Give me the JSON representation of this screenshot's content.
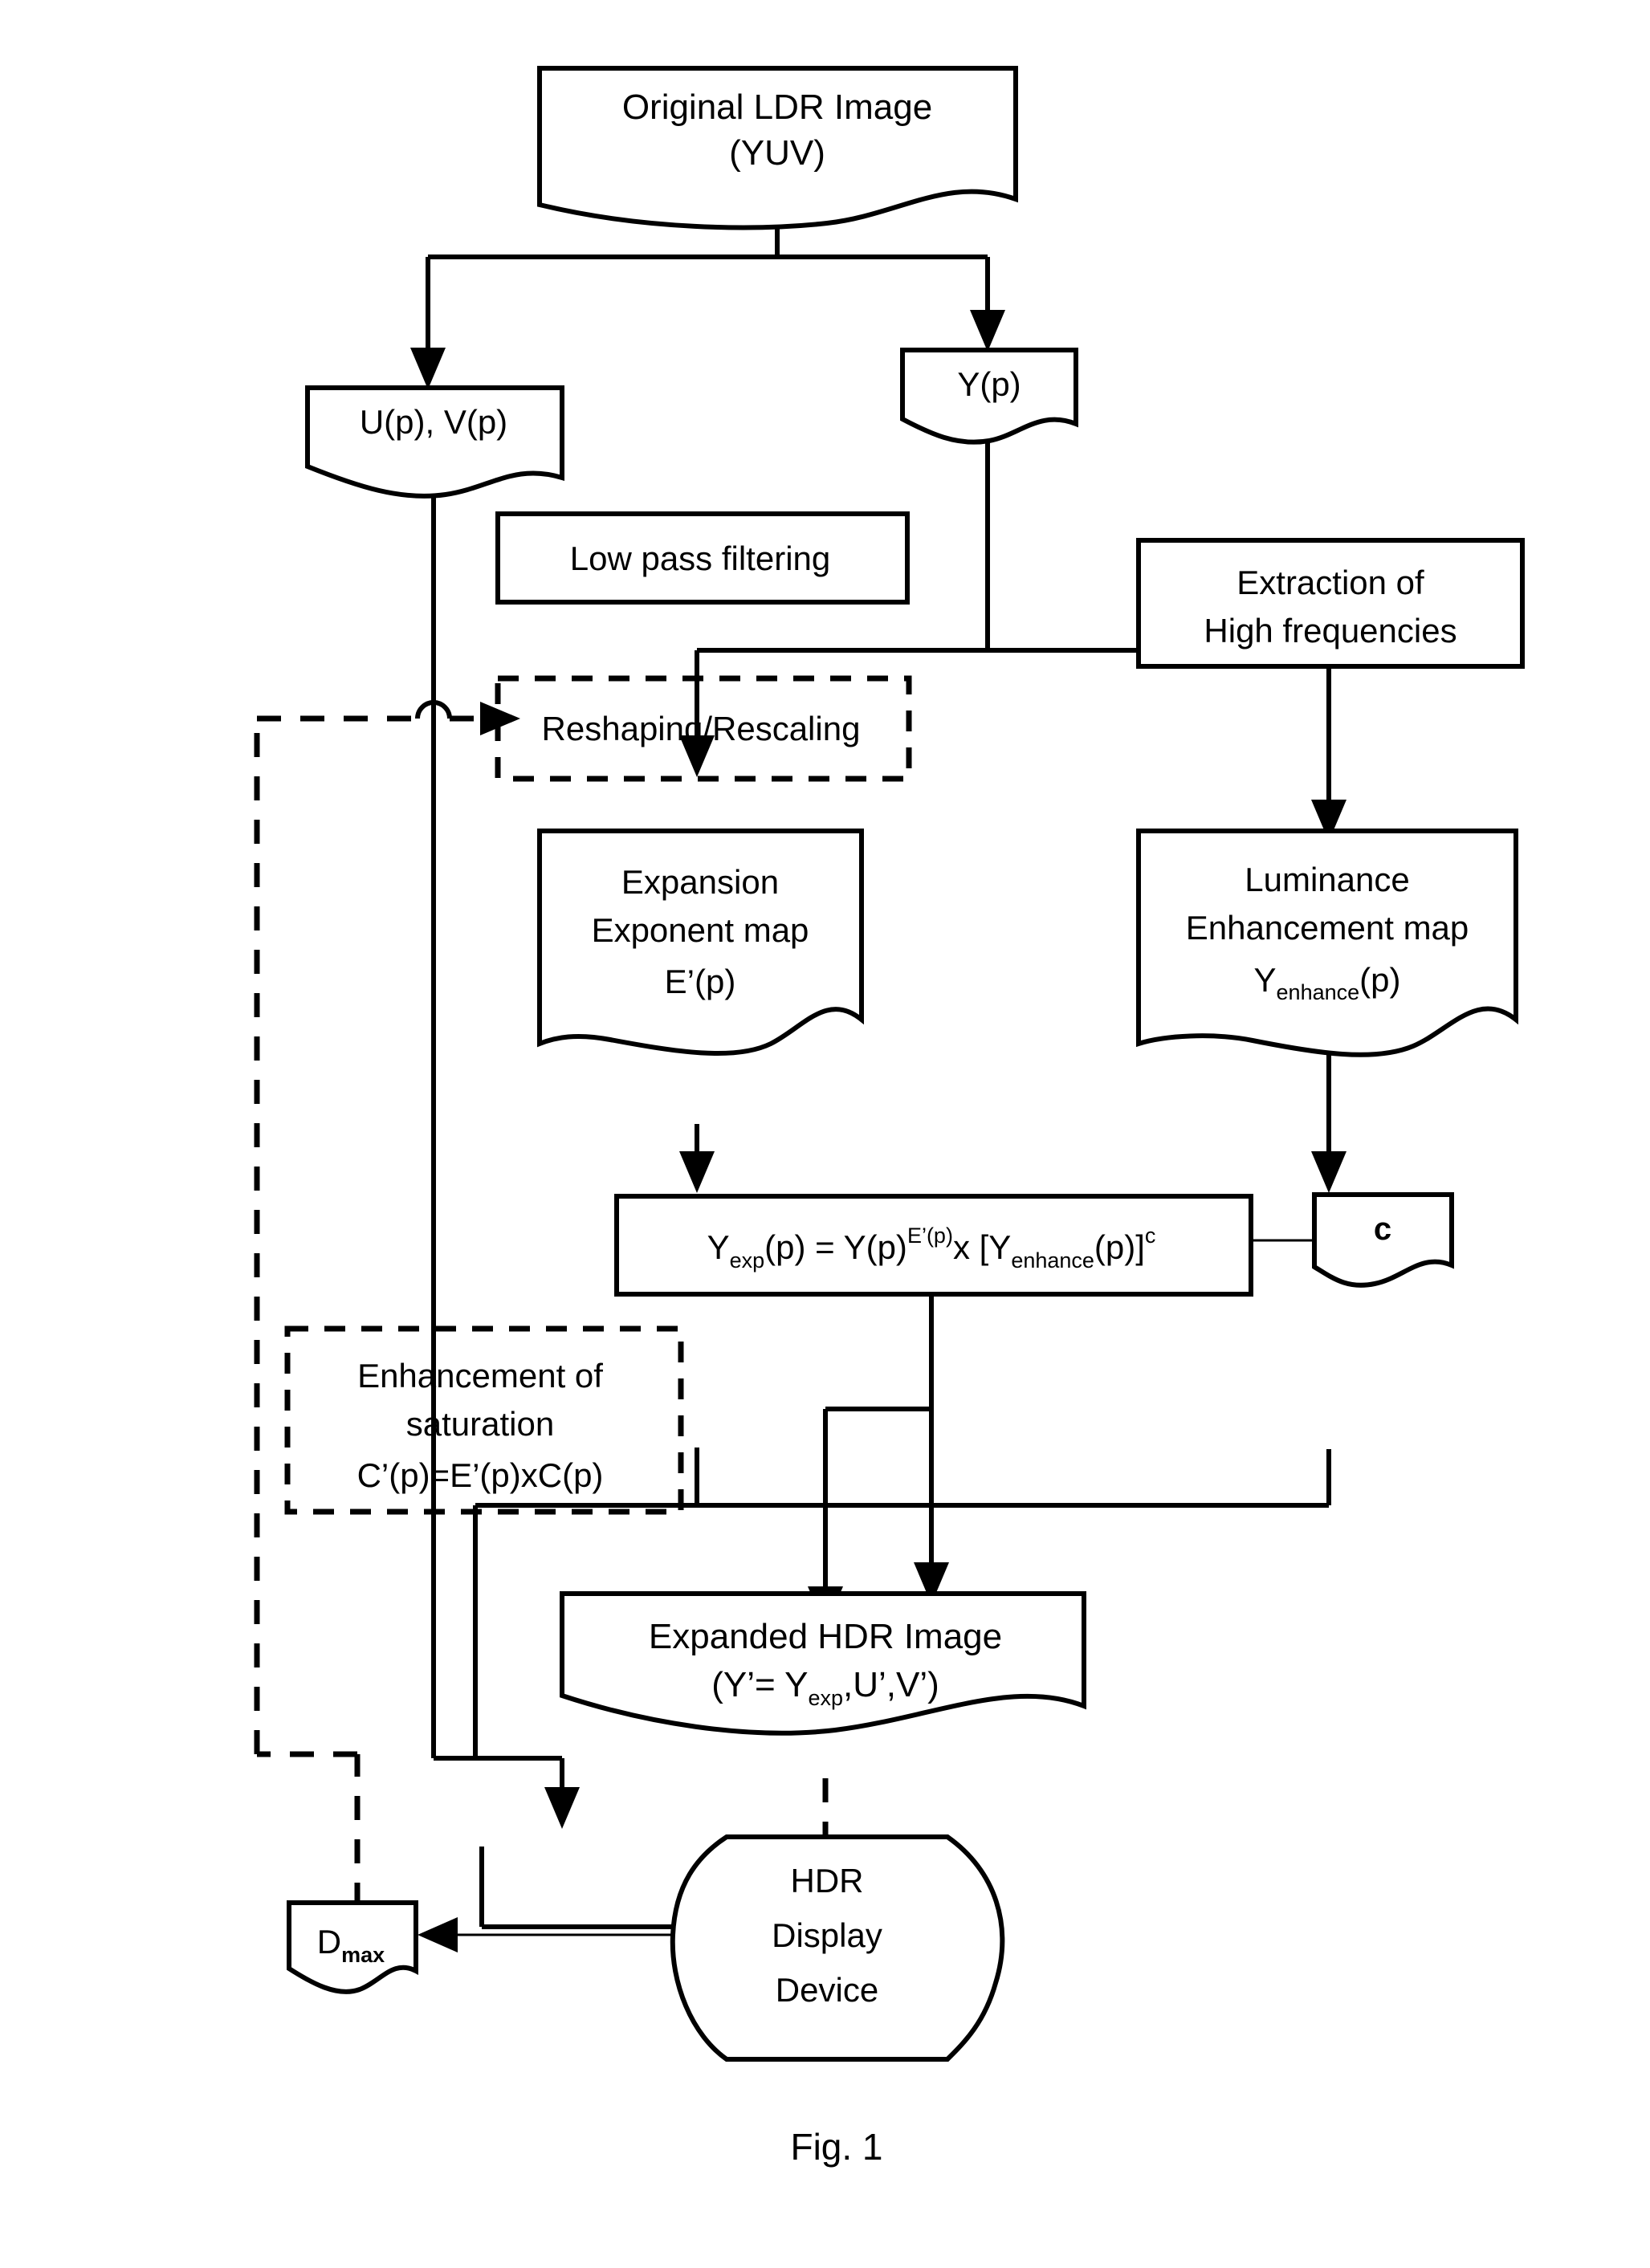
{
  "figure": {
    "caption": "Fig. 1",
    "title_nodes": {
      "original_ldr": {
        "line1": "Original LDR Image",
        "line2": "(YUV)"
      },
      "uv": {
        "label": "U(p), V(p)"
      },
      "y": {
        "label": "Y(p)"
      },
      "low_pass": {
        "label": "Low pass filtering"
      },
      "reshaping": {
        "label": "Reshaping/Rescaling"
      },
      "extraction": {
        "line1": "Extraction of",
        "line2": "High frequencies"
      },
      "expansion_map": {
        "line1": "Expansion",
        "line2": "Exponent map",
        "line3": "E’(p)"
      },
      "luminance_map": {
        "line1": "Luminance",
        "line2": "Enhancement map",
        "line3_base": "Y",
        "line3_sub": "enhance",
        "line3_tail": "(p)"
      },
      "formula": {
        "p1": "Y",
        "p1_sub": "exp",
        "p2": "(p) = Y(p)",
        "p2_sup": "E’(p)",
        "p3": "x [Y",
        "p3_sub": "enhance",
        "p4": "(p)]",
        "p4_sup": "c"
      },
      "c_param": {
        "label": "c"
      },
      "saturation": {
        "line1": "Enhancement of",
        "line2": "saturation",
        "line3": "C’(p)=E’(p)xC(p)"
      },
      "expanded_hdr": {
        "line1": "Expanded HDR Image",
        "line2_a": "(Y’= Y",
        "line2_sub": "exp",
        "line2_b": ",U’,V’)"
      },
      "hdr_display": {
        "line1": "HDR",
        "line2": "Display",
        "line3": "Device"
      },
      "dmax": {
        "base": "D",
        "sub": "max"
      }
    }
  },
  "chart_data": {
    "type": "diagram",
    "title": "Fig. 1",
    "subtype": "flowchart",
    "nodes": [
      {
        "id": "original_ldr",
        "shape": "document",
        "text": "Original LDR Image (YUV)"
      },
      {
        "id": "uv",
        "shape": "document",
        "text": "U(p), V(p)"
      },
      {
        "id": "y",
        "shape": "document",
        "text": "Y(p)"
      },
      {
        "id": "low_pass",
        "shape": "rect",
        "text": "Low pass filtering"
      },
      {
        "id": "reshaping",
        "shape": "rect-dashed",
        "text": "Reshaping/Rescaling"
      },
      {
        "id": "extraction",
        "shape": "rect",
        "text": "Extraction of High frequencies"
      },
      {
        "id": "expansion_map",
        "shape": "document",
        "text": "Expansion Exponent map E’(p)"
      },
      {
        "id": "luminance_map",
        "shape": "document",
        "text": "Luminance Enhancement map Yenhance(p)"
      },
      {
        "id": "formula",
        "shape": "rect",
        "text": "Yexp(p) = Y(p)^E’(p) x [Yenhance(p)]^c"
      },
      {
        "id": "c_param",
        "shape": "document",
        "text": "c"
      },
      {
        "id": "saturation",
        "shape": "rect-dashed",
        "text": "Enhancement of saturation C’(p)=E’(p)xC(p)"
      },
      {
        "id": "expanded_hdr",
        "shape": "document",
        "text": "Expanded HDR Image (Y’= Yexp,U’,V’)"
      },
      {
        "id": "hdr_display",
        "shape": "rounded-terminal",
        "text": "HDR Display Device"
      },
      {
        "id": "dmax",
        "shape": "document",
        "text": "Dmax"
      }
    ],
    "edges": [
      {
        "from": "original_ldr",
        "to": "uv",
        "style": "solid"
      },
      {
        "from": "original_ldr",
        "to": "y",
        "style": "solid"
      },
      {
        "from": "y",
        "to": "low_pass",
        "style": "solid"
      },
      {
        "from": "y",
        "to": "extraction",
        "style": "solid"
      },
      {
        "from": "low_pass",
        "to": "reshaping",
        "style": "solid"
      },
      {
        "from": "reshaping",
        "to": "expansion_map",
        "style": "solid"
      },
      {
        "from": "extraction",
        "to": "luminance_map",
        "style": "solid"
      },
      {
        "from": "expansion_map",
        "to": "formula",
        "style": "solid"
      },
      {
        "from": "luminance_map",
        "to": "formula",
        "style": "solid"
      },
      {
        "from": "c_param",
        "to": "formula",
        "style": "solid-thin"
      },
      {
        "from": "expansion_map",
        "to": "saturation",
        "style": "solid"
      },
      {
        "from": "uv",
        "to": "saturation",
        "style": "solid"
      },
      {
        "from": "formula",
        "to": "expanded_hdr",
        "style": "solid"
      },
      {
        "from": "saturation",
        "to": "expanded_hdr",
        "style": "solid"
      },
      {
        "from": "expanded_hdr",
        "to": "hdr_display",
        "style": "dashed"
      },
      {
        "from": "hdr_display",
        "to": "dmax",
        "style": "solid-thin"
      },
      {
        "from": "dmax",
        "to": "reshaping",
        "style": "dashed"
      }
    ]
  }
}
